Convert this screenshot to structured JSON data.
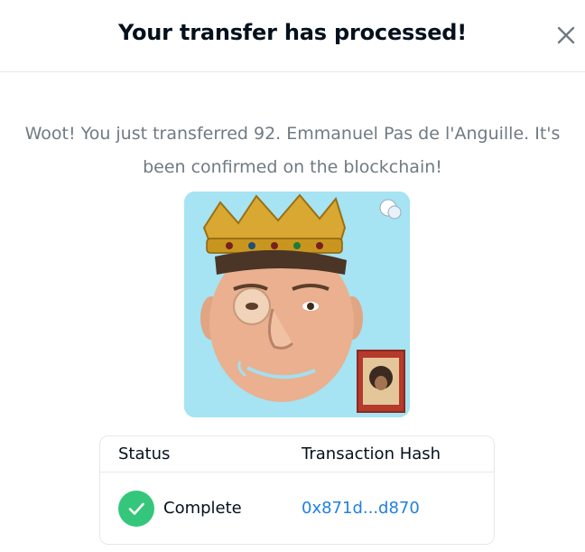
{
  "modal": {
    "title": "Your transfer has processed!",
    "close_icon": "close-icon",
    "message_line1": "Woot! You just transferred 92. Emmanuel Pas de l'Anguille. It's",
    "message_line2": "been confirmed on the blockchain!",
    "nft_image_background": "#a6e3f3"
  },
  "table": {
    "headers": [
      "Status",
      "Transaction Hash"
    ],
    "row": {
      "status": "Complete",
      "status_icon": "check-circle-icon",
      "status_color": "#34c77b",
      "hash": "0x871d...d870",
      "hash_color": "#2081e2"
    }
  }
}
